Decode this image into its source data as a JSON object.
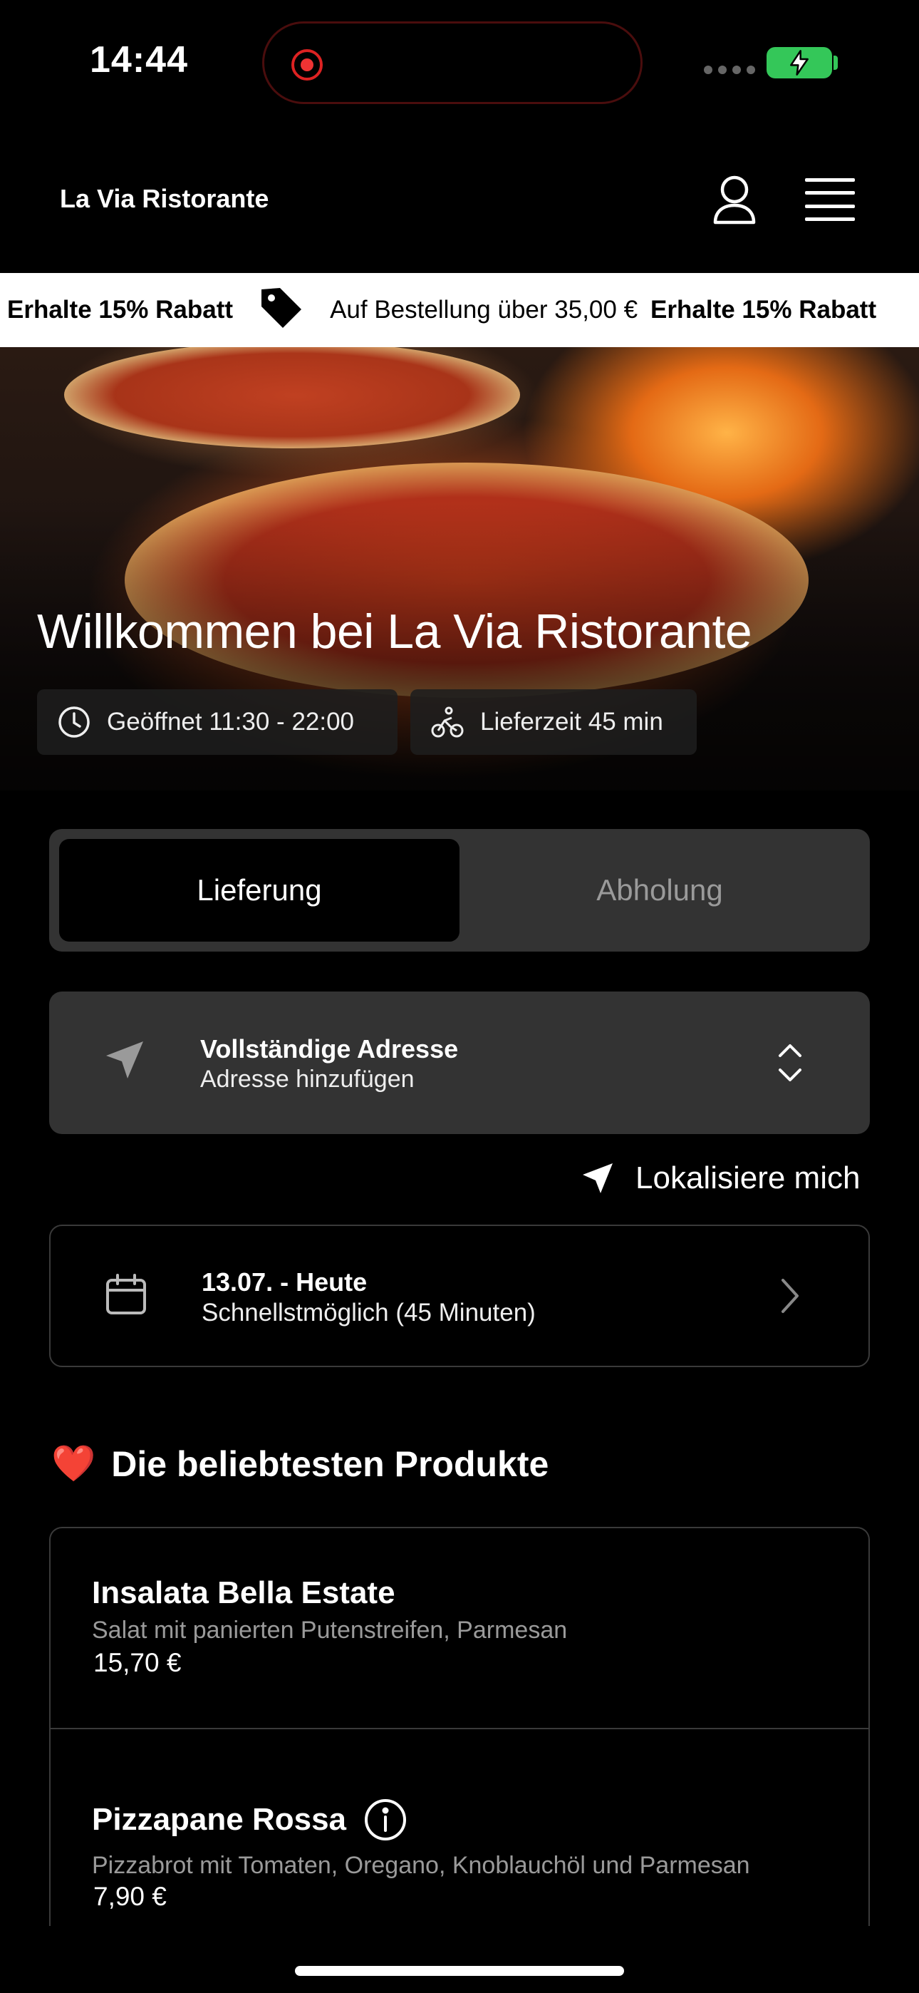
{
  "status_bar": {
    "time": "14:44"
  },
  "header": {
    "brand": "La Via Ristorante"
  },
  "promo": {
    "items": [
      {
        "text": "Erhalte 15% Rabatt",
        "bold": true
      },
      {
        "text": "Auf Bestellung über 35,00 €",
        "bold": false
      },
      {
        "text": "Erhalte 15% Rabatt",
        "bold": true
      }
    ]
  },
  "hero": {
    "title": "Willkommen bei La Via Ristorante",
    "opening_hours": "Geöffnet 11:30 - 22:00",
    "delivery_time": "Lieferzeit 45 min"
  },
  "order_mode": {
    "options": [
      "Lieferung",
      "Abholung"
    ],
    "selected": "Lieferung"
  },
  "address": {
    "title": "Vollständige Adresse",
    "subtitle": "Adresse hinzufügen"
  },
  "locate_label": "Lokalisiere mich",
  "schedule": {
    "date": "13.07. - Heute",
    "time": "Schnellstmöglich (45 Minuten)"
  },
  "popular": {
    "emoji": "❤️",
    "title": "Die beliebtesten Produkte",
    "products": [
      {
        "name": "Insalata Bella Estate",
        "description": "Salat mit panierten Putenstreifen, Parmesan",
        "price": "15,70 €"
      },
      {
        "name": "Pizzapane Rossa",
        "description": "Pizzabrot mit Tomaten, Oregano, Knoblauchöl und Parmesan",
        "price": "7,90 €"
      }
    ]
  },
  "colors": {
    "background": "#000000",
    "surface": "#333333",
    "battery": "#34c759",
    "recording": "#e33333"
  }
}
